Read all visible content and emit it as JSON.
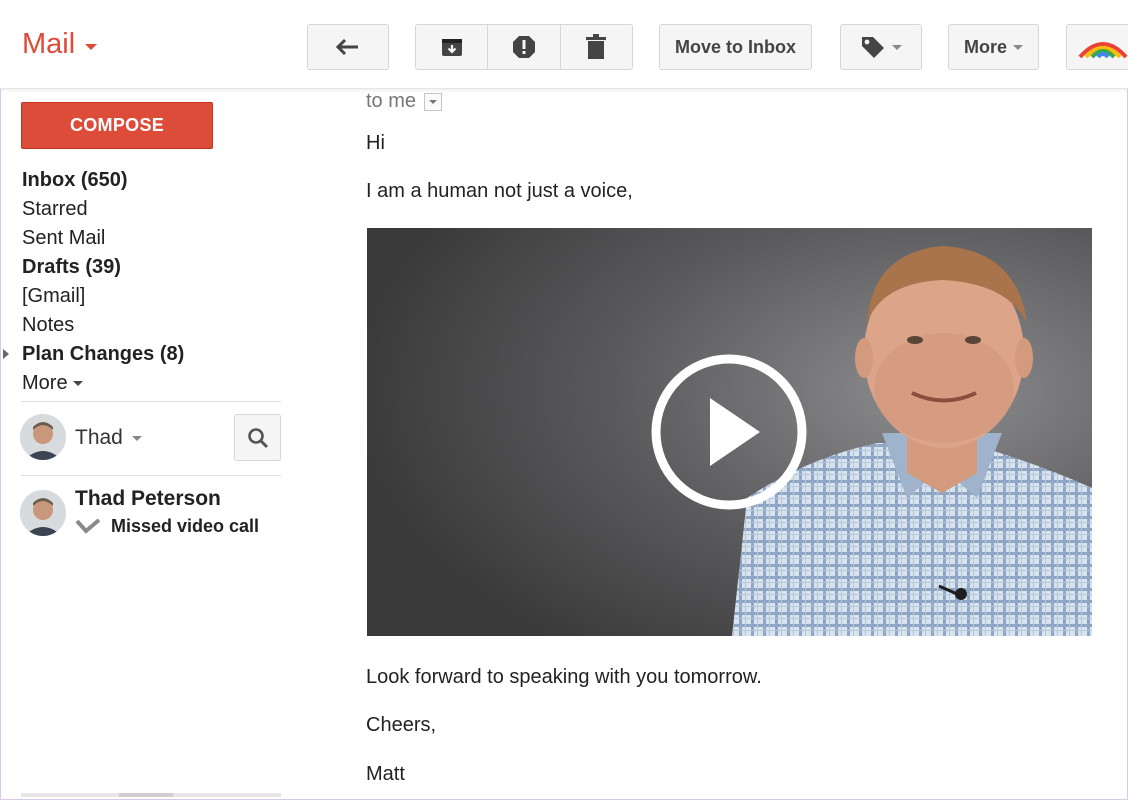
{
  "header": {
    "app_title": "Mail",
    "toolbar": {
      "move_to_inbox_label": "Move to Inbox",
      "more_label": "More"
    }
  },
  "sidebar": {
    "compose_label": "COMPOSE",
    "items": [
      {
        "label": "Inbox (650)",
        "bold": true
      },
      {
        "label": "Starred",
        "bold": false
      },
      {
        "label": "Sent Mail",
        "bold": false
      },
      {
        "label": "Drafts (39)",
        "bold": true
      },
      {
        "label": "[Gmail]",
        "bold": false
      },
      {
        "label": "Notes",
        "bold": false
      },
      {
        "label": "Plan Changes (8)",
        "bold": true
      }
    ],
    "more_label": "More"
  },
  "hangouts": {
    "current_user": "Thad",
    "contacts": [
      {
        "name": "Thad Peterson",
        "status": "Missed video call"
      }
    ]
  },
  "message": {
    "recipient": "to me",
    "greeting": "Hi",
    "line1": "I am a human not just a voice,",
    "line2": "Look forward to speaking with you tomorrow.",
    "signoff": "Cheers,",
    "signature": "Matt"
  },
  "icons": {
    "reply": "reply-icon",
    "archive": "archive-icon",
    "spam": "report-spam-icon",
    "delete": "trash-icon",
    "labels": "label-tag-icon",
    "hangouts_logo": "rainbow-logo-icon",
    "search": "search-icon",
    "play": "play-icon",
    "missed_call": "missed-call-icon"
  },
  "colors": {
    "brand_red": "#dd4b39",
    "button_bg": "#f5f5f5",
    "button_border": "#d6d6d6"
  }
}
